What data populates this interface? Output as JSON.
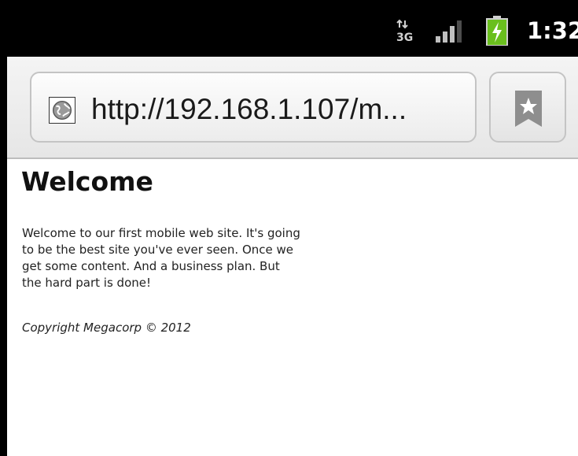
{
  "status_bar": {
    "network_label": "3G",
    "network_icon": "data-3g-icon",
    "signal_icon": "signal-strength-icon",
    "battery_icon": "battery-charging-icon",
    "time": "1:32"
  },
  "address_bar": {
    "url": "http://192.168.1.107/m...",
    "site_icon": "globe-icon",
    "bookmark_icon": "bookmark-star-icon"
  },
  "page": {
    "heading": "Welcome",
    "body": "Welcome to our first mobile web site. It's going to be the best site you've ever seen. Once we get some content. And a business plan. But the hard part is done!",
    "footer": "Copyright Megacorp © 2012"
  },
  "colors": {
    "status_bar_bg": "#000000",
    "battery_green": "#6abf1e",
    "address_bar_bg": "#ececec"
  }
}
